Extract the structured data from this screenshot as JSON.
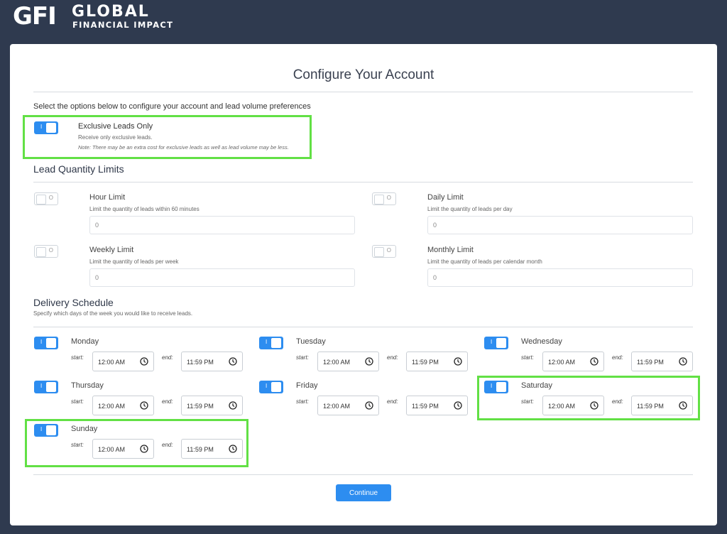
{
  "brand": {
    "mark": "GFI",
    "name_line1": "GLOBAL",
    "name_line2": "FINANCIAL IMPACT"
  },
  "page": {
    "title": "Configure Your Account",
    "intro": "Select the options below to configure your account and lead volume preferences"
  },
  "exclusive": {
    "enabled": true,
    "label": "Exclusive Leads Only",
    "description": "Receive only exclusive leads.",
    "note": "Note: There may be an extra cost for exclusive leads as well as lead volume may be less."
  },
  "limits": {
    "heading": "Lead Quantity Limits",
    "items": [
      {
        "label": "Hour Limit",
        "description": "Limit the quantity of leads within 60 minutes",
        "value": "0",
        "enabled": false,
        "toggle_mark": "O"
      },
      {
        "label": "Daily Limit",
        "description": "Limit the quantity of leads per day",
        "value": "0",
        "enabled": false,
        "toggle_mark": "O"
      },
      {
        "label": "Weekly Limit",
        "description": "Limit the quantity of leads per week",
        "value": "0",
        "enabled": false,
        "toggle_mark": "O"
      },
      {
        "label": "Monthly Limit",
        "description": "Limit the quantity of leads per calendar month",
        "value": "0",
        "enabled": false,
        "toggle_mark": "O"
      }
    ]
  },
  "schedule": {
    "heading": "Delivery Schedule",
    "description": "Specify which days of the week you would like to receive leads.",
    "start_label": "start:",
    "end_label": "end:",
    "toggle_mark": "I",
    "days": [
      {
        "name": "Monday",
        "start": "12:00 AM",
        "end": "11:59 PM",
        "enabled": true
      },
      {
        "name": "Tuesday",
        "start": "12:00 AM",
        "end": "11:59 PM",
        "enabled": true
      },
      {
        "name": "Wednesday",
        "start": "12:00 AM",
        "end": "11:59 PM",
        "enabled": true
      },
      {
        "name": "Thursday",
        "start": "12:00 AM",
        "end": "11:59 PM",
        "enabled": true
      },
      {
        "name": "Friday",
        "start": "12:00 AM",
        "end": "11:59 PM",
        "enabled": true
      },
      {
        "name": "Saturday",
        "start": "12:00 AM",
        "end": "11:59 PM",
        "enabled": true
      },
      {
        "name": "Sunday",
        "start": "12:00 AM",
        "end": "11:59 PM",
        "enabled": true
      }
    ]
  },
  "actions": {
    "continue_label": "Continue"
  },
  "colors": {
    "background": "#2f3a4f",
    "accent": "#2d8df0",
    "highlight": "#62e045"
  }
}
